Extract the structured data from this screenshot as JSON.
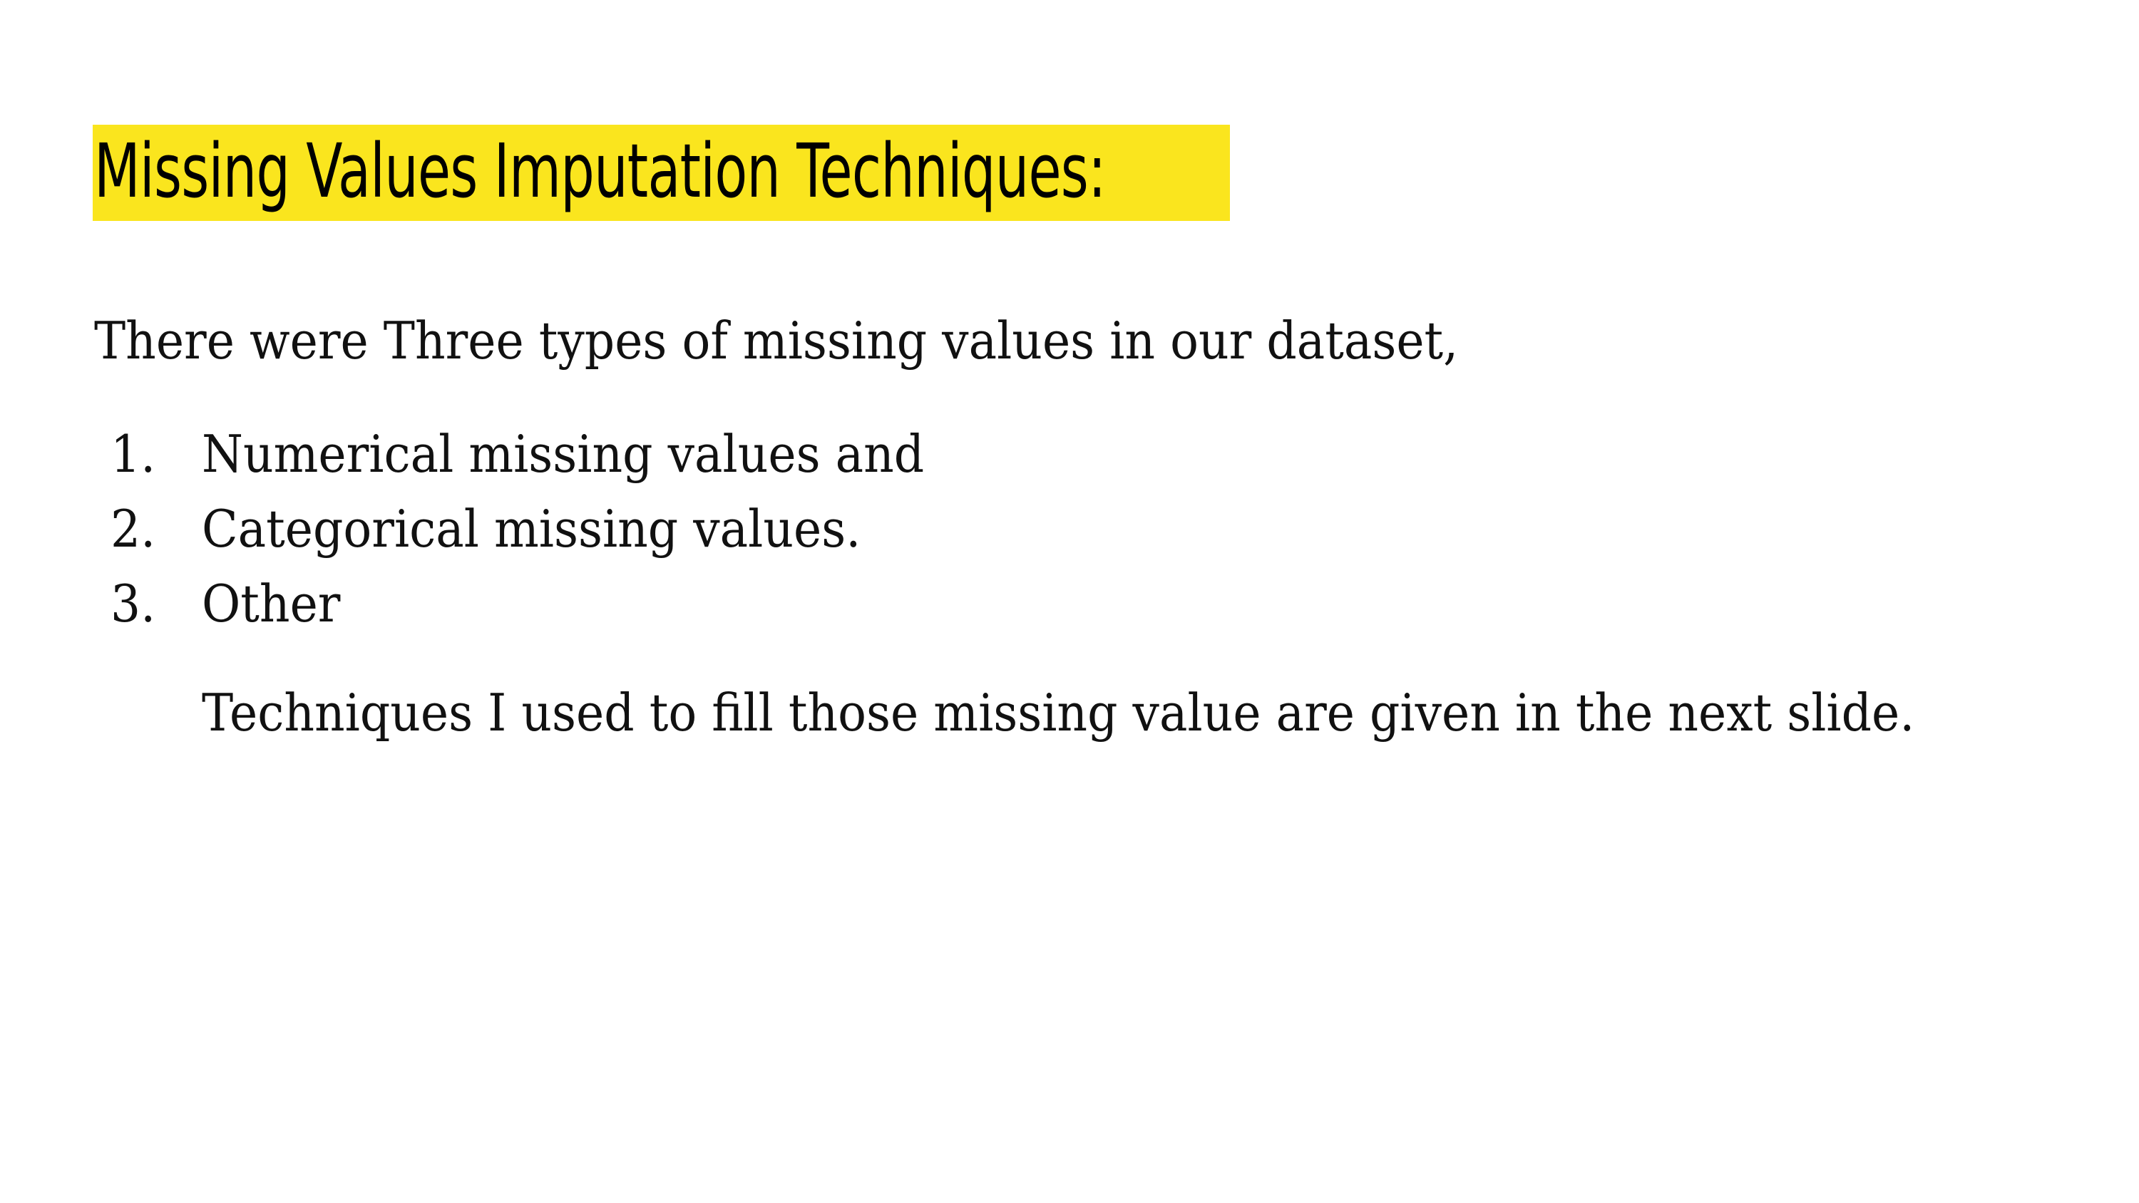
{
  "slide": {
    "title": "Missing Values Imputation Techniques:",
    "intro": "There were Three types of missing values in our dataset,",
    "list": [
      {
        "number": "1.",
        "text": "Numerical missing values and"
      },
      {
        "number": "2.",
        "text": "Categorical missing values."
      },
      {
        "number": "3.",
        "text": "Other"
      }
    ],
    "note": "Techniques I used to fill those missing value are given in the next slide."
  },
  "colors": {
    "highlight": "#fae51e",
    "text": "#111111",
    "background": "#ffffff"
  }
}
